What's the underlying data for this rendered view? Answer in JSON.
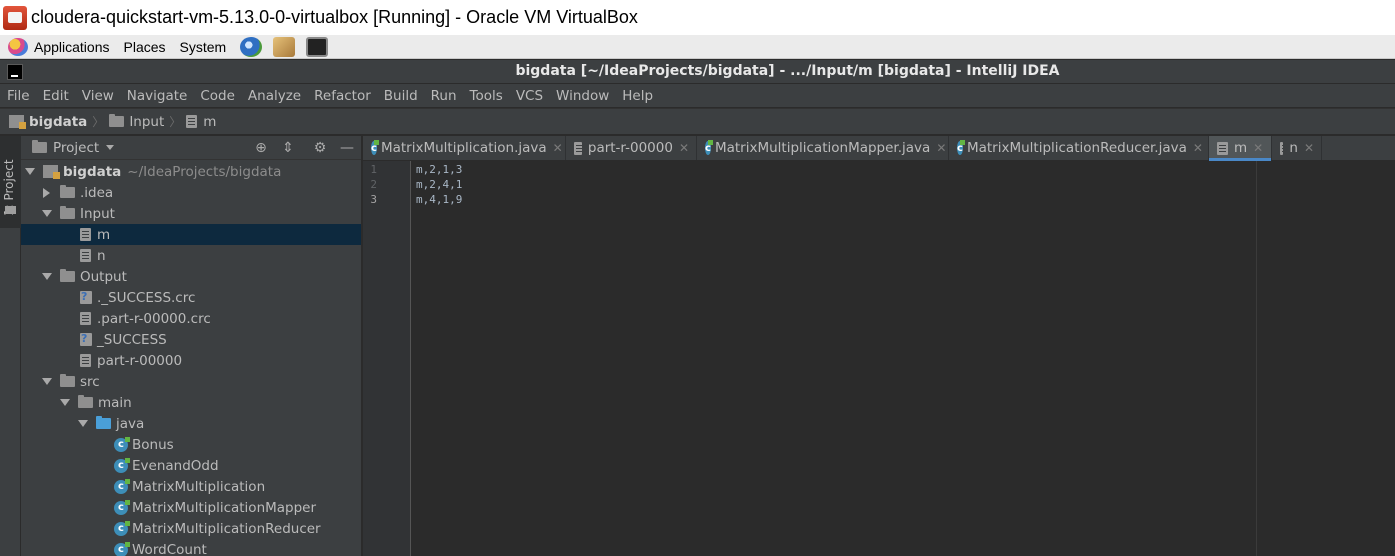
{
  "vbox": {
    "title": "cloudera-quickstart-vm-5.13.0-0-virtualbox [Running] - Oracle VM VirtualBox"
  },
  "panel": {
    "applications": "Applications",
    "places": "Places",
    "system": "System"
  },
  "idea": {
    "title": "bigdata [~/IdeaProjects/bigdata] - .../Input/m [bigdata] - IntelliJ IDEA"
  },
  "menu": [
    "File",
    "Edit",
    "View",
    "Navigate",
    "Code",
    "Analyze",
    "Refactor",
    "Build",
    "Run",
    "Tools",
    "VCS",
    "Window",
    "Help"
  ],
  "breadcrumb": [
    "bigdata",
    "Input",
    "m"
  ],
  "sidestripe": {
    "project_label": "1: Project"
  },
  "project_panel": {
    "title": "Project",
    "tree": [
      {
        "label": "bigdata",
        "extra": "~/IdeaProjects/bigdata",
        "icon": "module-icon",
        "expanded": true
      },
      {
        "label": ".idea",
        "icon": "folder-icon",
        "expanded": false
      },
      {
        "label": "Input",
        "icon": "folder-icon",
        "expanded": true
      },
      {
        "label": "m",
        "icon": "text-file-icon",
        "selected": true
      },
      {
        "label": "n",
        "icon": "text-file-icon"
      },
      {
        "label": "Output",
        "icon": "folder-icon",
        "expanded": true
      },
      {
        "label": "._SUCCESS.crc",
        "icon": "unknown-file-icon"
      },
      {
        "label": ".part-r-00000.crc",
        "icon": "text-file-icon"
      },
      {
        "label": "_SUCCESS",
        "icon": "unknown-file-icon"
      },
      {
        "label": "part-r-00000",
        "icon": "text-file-icon"
      },
      {
        "label": "src",
        "icon": "folder-icon",
        "expanded": true
      },
      {
        "label": "main",
        "icon": "folder-icon",
        "expanded": true
      },
      {
        "label": "java",
        "icon": "source-folder-icon",
        "expanded": true
      },
      {
        "label": "Bonus",
        "icon": "java-class-icon"
      },
      {
        "label": "EvenandOdd",
        "icon": "java-class-icon"
      },
      {
        "label": "MatrixMultiplication",
        "icon": "java-class-icon"
      },
      {
        "label": "MatrixMultiplicationMapper",
        "icon": "java-class-icon"
      },
      {
        "label": "MatrixMultiplicationReducer",
        "icon": "java-class-icon"
      },
      {
        "label": "WordCount",
        "icon": "java-class-icon"
      }
    ]
  },
  "tabs": [
    {
      "label": "MatrixMultiplication.java",
      "icon": "java-class-icon"
    },
    {
      "label": "part-r-00000",
      "icon": "text-file-icon"
    },
    {
      "label": "MatrixMultiplicationMapper.java",
      "icon": "java-class-icon"
    },
    {
      "label": "MatrixMultiplicationReducer.java",
      "icon": "java-class-icon"
    },
    {
      "label": "m",
      "icon": "text-file-icon",
      "active": true
    },
    {
      "label": "n",
      "icon": "text-file-icon"
    }
  ],
  "editor": {
    "lines": [
      {
        "num": "1",
        "text": "m,2,1,3"
      },
      {
        "num": "2",
        "text": "m,2,4,1"
      },
      {
        "num": "3",
        "text": "m,4,1,9"
      }
    ]
  },
  "colors": {
    "accent": "#4a88c7",
    "selection": "#0d293e",
    "panel_bg": "#3c3f41",
    "editor_bg": "#2b2b2b"
  }
}
